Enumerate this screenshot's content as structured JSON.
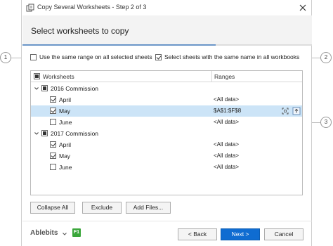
{
  "window": {
    "title": "Copy Several Worksheets - Step 2 of 3",
    "close_icon": "close-icon",
    "app_icon": "copy-sheets-icon"
  },
  "heading": "Select worksheets to copy",
  "options": {
    "same_range": {
      "label": "Use the same range on all selected sheets",
      "checked": false
    },
    "same_name": {
      "label": "Select sheets with the same name in all workbooks",
      "checked": true
    }
  },
  "tree": {
    "columns": {
      "worksheets": "Worksheets",
      "ranges": "Ranges"
    },
    "header_checkbox_state": "partial",
    "rows": [
      {
        "label": "2016 Commission",
        "range": "",
        "type": "group",
        "state": "partial",
        "expanded": true
      },
      {
        "label": "April",
        "range": "<All data>",
        "type": "sheet",
        "state": "checked",
        "selected": false
      },
      {
        "label": "May",
        "range": "$A$1:$F$8",
        "type": "sheet",
        "state": "checked",
        "selected": true
      },
      {
        "label": "June",
        "range": "<All data>",
        "type": "sheet",
        "state": "unchecked",
        "selected": false
      },
      {
        "label": "2017 Commission",
        "range": "",
        "type": "group",
        "state": "partial",
        "expanded": true
      },
      {
        "label": "April",
        "range": "<All data>",
        "type": "sheet",
        "state": "checked",
        "selected": false
      },
      {
        "label": "May",
        "range": "<All data>",
        "type": "sheet",
        "state": "checked",
        "selected": false
      },
      {
        "label": "June",
        "range": "<All data>",
        "type": "sheet",
        "state": "unchecked",
        "selected": false
      }
    ],
    "row_icons": [
      "select-range-icon",
      "upload-icon"
    ]
  },
  "tree_buttons": {
    "collapse_all": "Collapse All",
    "exclude": "Exclude",
    "add_files": "Add Files..."
  },
  "footer": {
    "brand": "Ablebits",
    "brand_menu_icon": "chevron-down-icon",
    "help_badge": "F1",
    "back": "< Back",
    "next": "Next >",
    "cancel": "Cancel"
  },
  "callouts": [
    "1",
    "2",
    "3"
  ],
  "wizard_progress": {
    "step": 2,
    "total": 3
  },
  "colors": {
    "accent": "#0f6cd1",
    "selection": "#cce4f7",
    "header_band": "#f3f3f3",
    "brand_badge": "#3aa63a"
  }
}
